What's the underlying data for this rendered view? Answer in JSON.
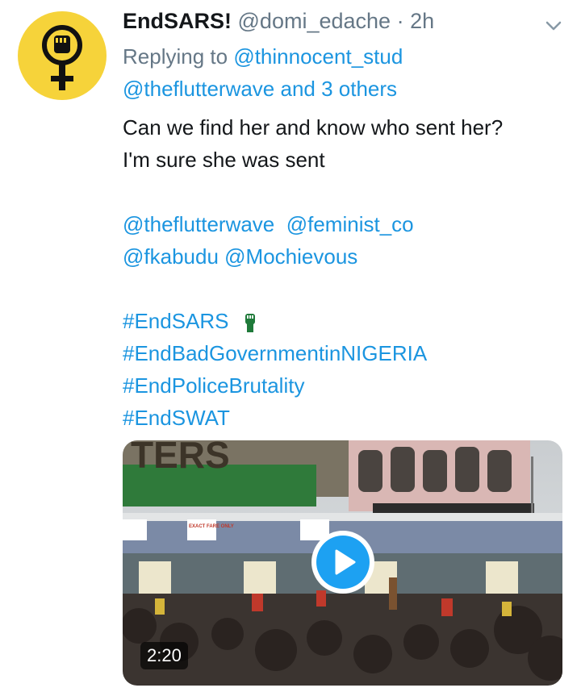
{
  "tweet": {
    "display_name": "EndSARS!",
    "handle": "@domi_edache",
    "separator": "·",
    "time": "2h",
    "menu_icon": "chevron-down-icon",
    "avatar_icon": "raised-fist-female-symbol-icon",
    "reply": {
      "prefix": "Replying to",
      "mention1": "@thinnocent_stud",
      "mention2": "@theflutterwave and 3 others"
    },
    "text": {
      "line1": "Can we find her and know who sent her?",
      "line2": "I'm sure she was sent"
    },
    "mentions": [
      "@theflutterwave",
      "@feminist_co",
      "@fkabudu",
      "@Mochievous"
    ],
    "hashtags": [
      "#EndSARS",
      "#EndBadGovernmentinNIGERIA",
      "#EndPoliceBrutality",
      "#EndSWAT"
    ],
    "hashtag_emoji": "green-raised-fist-icon",
    "media": {
      "type": "video",
      "duration": "2:20",
      "play_icon": "play-icon",
      "sign_text": "EXACT FARE ONLY",
      "billboard_text": "TERS"
    }
  },
  "colors": {
    "link_blue": "#1b95e0",
    "muted_gray": "#657786",
    "avatar_yellow": "#f6d33a",
    "play_blue": "#1da1f2"
  }
}
